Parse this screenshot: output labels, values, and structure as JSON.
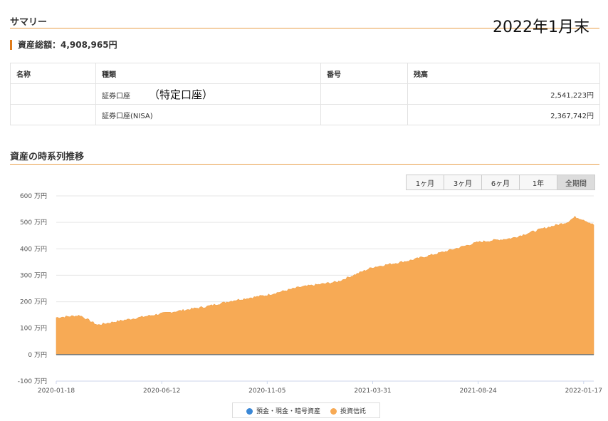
{
  "summary": {
    "title": "サマリー",
    "date": "2022年1月末"
  },
  "total": {
    "label": "資産総額：4,908,965円"
  },
  "table": {
    "headers": [
      "名称",
      "種類",
      "番号",
      "残高"
    ],
    "rows": [
      {
        "name": "",
        "type": "証券口座",
        "note": "（特定口座）",
        "number": "",
        "balance": "2,541,223円"
      },
      {
        "name": "",
        "type": "証券口座(NISA)",
        "note": "",
        "number": "",
        "balance": "2,367,742円"
      }
    ]
  },
  "history": {
    "title": "資産の時系列推移",
    "ranges": [
      "1ヶ月",
      "3ヶ月",
      "6ヶ月",
      "1年",
      "全期間"
    ],
    "active_range": "全期間"
  },
  "colors": {
    "accent": "#e8a04a",
    "fund": "#f7aa55",
    "cash": "#3b88d6"
  },
  "chart_data": {
    "type": "area",
    "x_ticks": [
      "2020-01-18",
      "2020-06-12",
      "2020-11-05",
      "2021-03-31",
      "2021-08-24",
      "2022-01-17"
    ],
    "y_ticks": [
      "600 万円",
      "500 万円",
      "400 万円",
      "300 万円",
      "200 万円",
      "100 万円",
      "0 万円",
      "-100 万円"
    ],
    "ylim": [
      -100,
      600
    ],
    "x_range": [
      "2020-01-18",
      "2022-01-31"
    ],
    "series": [
      {
        "name": "預金・現金・暗号資産",
        "color": "#3b88d6",
        "points": [
          [
            "2020-01-18",
            0
          ],
          [
            "2022-01-31",
            0
          ]
        ]
      },
      {
        "name": "投資信託",
        "color": "#f7aa55",
        "points": [
          [
            "2020-01-18",
            140
          ],
          [
            "2020-02-20",
            148
          ],
          [
            "2020-03-15",
            112
          ],
          [
            "2020-04-10",
            125
          ],
          [
            "2020-06-12",
            155
          ],
          [
            "2020-08-10",
            180
          ],
          [
            "2020-09-20",
            205
          ],
          [
            "2020-11-05",
            225
          ],
          [
            "2020-12-20",
            255
          ],
          [
            "2021-02-10",
            275
          ],
          [
            "2021-03-31",
            330
          ],
          [
            "2021-05-20",
            355
          ],
          [
            "2021-07-10",
            390
          ],
          [
            "2021-08-24",
            425
          ],
          [
            "2021-10-10",
            440
          ],
          [
            "2021-11-20",
            475
          ],
          [
            "2021-12-25",
            500
          ],
          [
            "2022-01-05",
            520
          ],
          [
            "2022-01-17",
            510
          ],
          [
            "2022-01-31",
            490
          ]
        ]
      }
    ]
  }
}
